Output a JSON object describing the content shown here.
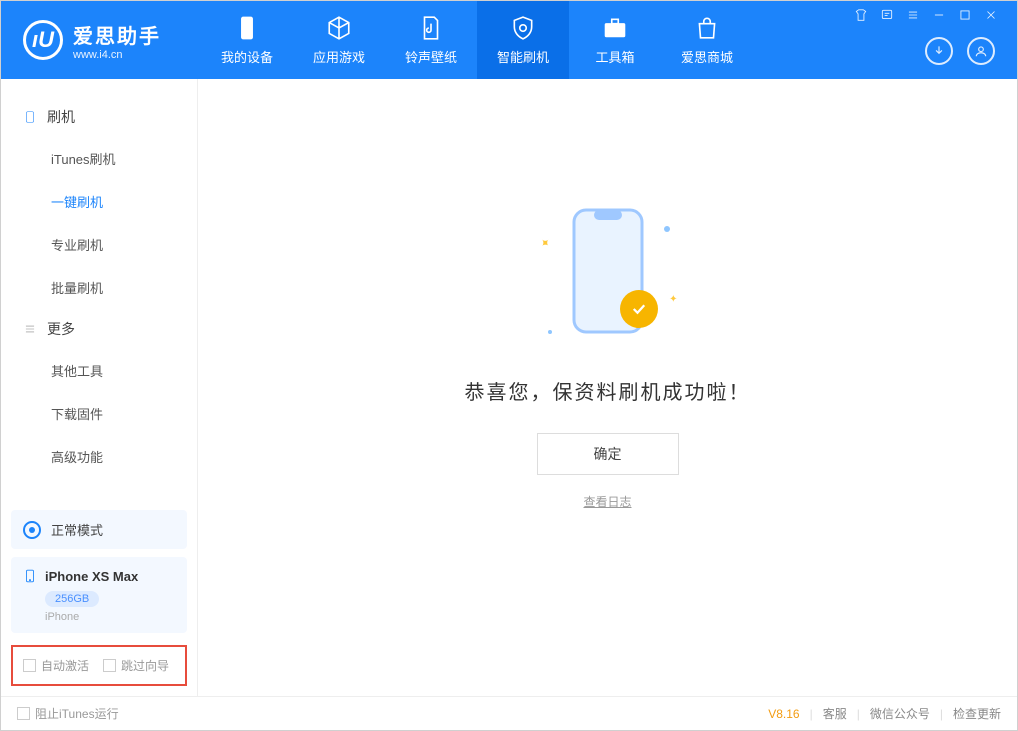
{
  "app": {
    "title": "爱思助手",
    "subtitle": "www.i4.cn"
  },
  "nav": {
    "tabs": [
      {
        "label": "我的设备"
      },
      {
        "label": "应用游戏"
      },
      {
        "label": "铃声壁纸"
      },
      {
        "label": "智能刷机"
      },
      {
        "label": "工具箱"
      },
      {
        "label": "爱思商城"
      }
    ]
  },
  "sidebar": {
    "group_flash": "刷机",
    "items_flash": [
      {
        "label": "iTunes刷机"
      },
      {
        "label": "一键刷机"
      },
      {
        "label": "专业刷机"
      },
      {
        "label": "批量刷机"
      }
    ],
    "group_more": "更多",
    "items_more": [
      {
        "label": "其他工具"
      },
      {
        "label": "下载固件"
      },
      {
        "label": "高级功能"
      }
    ],
    "mode": "正常模式",
    "device": {
      "name": "iPhone XS Max",
      "storage": "256GB",
      "type": "iPhone"
    },
    "opts": {
      "auto_activate": "自动激活",
      "skip_guide": "跳过向导"
    }
  },
  "main": {
    "success": "恭喜您，保资料刷机成功啦！",
    "ok": "确定",
    "view_log": "查看日志"
  },
  "footer": {
    "block_itunes": "阻止iTunes运行",
    "version": "V8.16",
    "links": [
      "客服",
      "微信公众号",
      "检查更新"
    ]
  }
}
